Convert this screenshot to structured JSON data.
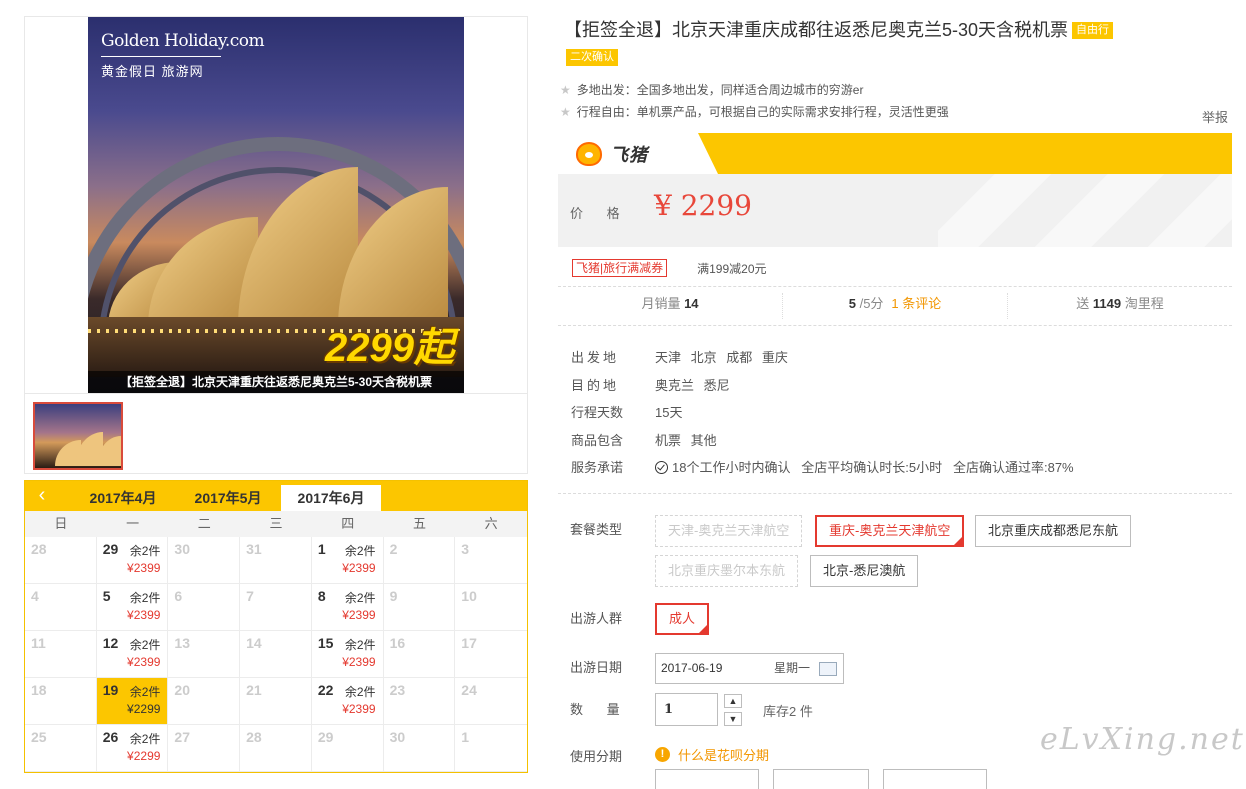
{
  "image": {
    "logo_en": "Golden Holiday.com",
    "logo_cn": "黄金假日 旅游网",
    "price_badge": "2299起",
    "caption": "【拒签全退】北京天津重庆往返悉尼奥克兰5-30天含税机票"
  },
  "calendar": {
    "prev_icon": "chevron-left-icon",
    "tabs": [
      "2017年4月",
      "2017年5月",
      "2017年6月"
    ],
    "active_tab": 2,
    "weekdays": [
      "日",
      "一",
      "二",
      "三",
      "四",
      "五",
      "六"
    ],
    "cells": [
      {
        "day": "28"
      },
      {
        "day": "29",
        "stock": "余2件",
        "price": "¥2399"
      },
      {
        "day": "30"
      },
      {
        "day": "31"
      },
      {
        "day": "1",
        "stock": "余2件",
        "price": "¥2399"
      },
      {
        "day": "2"
      },
      {
        "day": "3"
      },
      {
        "day": "4"
      },
      {
        "day": "5",
        "stock": "余2件",
        "price": "¥2399"
      },
      {
        "day": "6"
      },
      {
        "day": "7"
      },
      {
        "day": "8",
        "stock": "余2件",
        "price": "¥2399"
      },
      {
        "day": "9"
      },
      {
        "day": "10"
      },
      {
        "day": "11"
      },
      {
        "day": "12",
        "stock": "余2件",
        "price": "¥2399"
      },
      {
        "day": "13"
      },
      {
        "day": "14"
      },
      {
        "day": "15",
        "stock": "余2件",
        "price": "¥2399"
      },
      {
        "day": "16"
      },
      {
        "day": "17"
      },
      {
        "day": "18"
      },
      {
        "day": "19",
        "stock": "余2件",
        "price": "¥2299",
        "selected": true
      },
      {
        "day": "20"
      },
      {
        "day": "21"
      },
      {
        "day": "22",
        "stock": "余2件",
        "price": "¥2399"
      },
      {
        "day": "23"
      },
      {
        "day": "24"
      },
      {
        "day": "25"
      },
      {
        "day": "26",
        "stock": "余2件",
        "price": "¥2299"
      },
      {
        "day": "27"
      },
      {
        "day": "28"
      },
      {
        "day": "29"
      },
      {
        "day": "30"
      },
      {
        "day": "1"
      }
    ]
  },
  "product": {
    "title": "【拒签全退】北京天津重庆成都往返悉尼奥克兰5-30天含税机票",
    "tag_self": "自由行",
    "tag_confirm": "二次确认",
    "features": [
      "多地出发：全国多地出发，同样适合周边城市的穷游er",
      "行程自由：单机票产品，可根据自己的实际需求安排行程，灵活性更强"
    ],
    "report": "举报"
  },
  "price": {
    "brand": "飞猪",
    "label": "价 格",
    "value": "¥ 2299"
  },
  "coupon": {
    "tag": "飞猪|旅行满减券",
    "text": "满199减20元"
  },
  "stats": {
    "monthly_label": "月销量",
    "monthly_value": "14",
    "rating_value": "5",
    "rating_suffix": "/5分",
    "reviews": "1 条评论",
    "points_prefix": "送",
    "points_value": "1149",
    "points_suffix": "淘里程"
  },
  "info": [
    {
      "key": "出发地",
      "value": "天津 北京 成都 重庆"
    },
    {
      "key": "目的地",
      "value": "奥克兰 悉尼"
    },
    {
      "key": "行程天数",
      "value": "15天"
    },
    {
      "key": "商品包含",
      "value": "机票 其他"
    },
    {
      "key": "服务承诺",
      "value": "18个工作小时内确认   全店平均确认时长:5小时   全店确认通过率:87%"
    }
  ],
  "options": {
    "package_label": "套餐类型",
    "packages": [
      {
        "label": "天津-奥克兰天津航空",
        "state": "disabled"
      },
      {
        "label": "重庆-奥克兰天津航空",
        "state": "selected"
      },
      {
        "label": "北京重庆成都悉尼东航",
        "state": "normal"
      },
      {
        "label": "北京重庆墨尔本东航",
        "state": "disabled"
      },
      {
        "label": "北京-悉尼澳航",
        "state": "normal"
      }
    ],
    "crowd_label": "出游人群",
    "crowd_value": "成人",
    "date_label": "出游日期",
    "date_value": "2017-06-19",
    "date_weekday": "星期一",
    "qty_label": "数 量",
    "qty_value": "1",
    "stock_text": "库存2 件",
    "installment_label": "使用分期",
    "installment_link": "什么是花呗分期"
  },
  "watermark": "eLvXing.net"
}
